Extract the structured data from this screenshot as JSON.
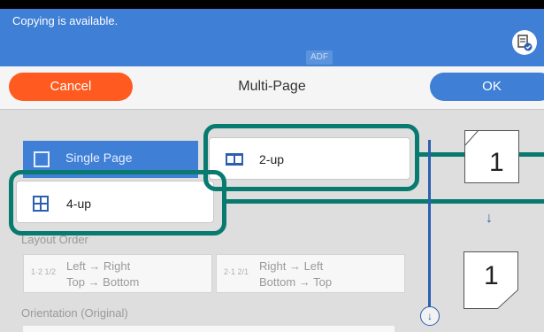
{
  "status": {
    "message": "Copying is available.",
    "adf_badge": "ADF",
    "info_icon": "document-check-icon"
  },
  "toolbar": {
    "cancel_label": "Cancel",
    "title": "Multi-Page",
    "ok_label": "OK"
  },
  "options": {
    "single_page": "Single Page",
    "two_up": "2-up",
    "four_up": "4-up"
  },
  "layout_order": {
    "label": "Layout Order",
    "left_right": {
      "icon_text": "1·2 1/2",
      "line1": "Left → Right",
      "line2": "Top → Bottom"
    },
    "right_left": {
      "icon_text": "2·1 2/1",
      "line1": "Right → Left",
      "line2": "Bottom → Top"
    }
  },
  "orientation": {
    "label": "Orientation (Original)"
  },
  "preview": {
    "top_page_number": "1",
    "bottom_page_number": "1"
  },
  "colors": {
    "accent": "#3f7fd6",
    "cancel": "#ff5a1f",
    "highlight": "#087a70"
  }
}
